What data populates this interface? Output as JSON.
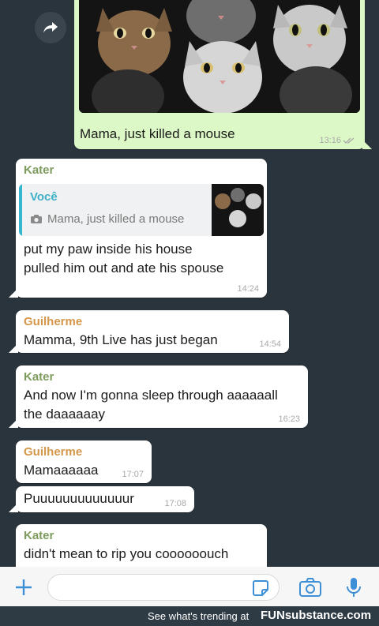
{
  "messages": [
    {
      "caption": "Mama, just killed a mouse",
      "time": "13:16"
    },
    {
      "sender": "Kater",
      "quote_sender": "Você",
      "quote_text": "Mama, just killed a mouse",
      "line1": "put my paw inside his house",
      "line2": "pulled him out and ate his spouse",
      "time": "14:24"
    },
    {
      "sender": "Guilherme",
      "text": "Mamma, 9th Live has just began",
      "time": "14:54"
    },
    {
      "sender": "Kater",
      "line1": "And now I'm gonna sleep through aaaaaall",
      "line2": "the daaaaaay",
      "time": "16:23"
    },
    {
      "sender": "Guilherme",
      "text": "Mamaaaaaa",
      "time": "17:07"
    },
    {
      "text": "Puuuuuuuuuuuuur",
      "time": "17:08"
    },
    {
      "sender": "Kater",
      "text": "didn't mean to rip you coooooouch"
    }
  ],
  "footer": {
    "text": "See what's trending at",
    "brand": "FUNsubstance.com"
  },
  "colors": {
    "chat_bg": "#2a343d",
    "outgoing": "#dcf8c6",
    "incoming": "#ffffff",
    "kater": "#7e9b5e",
    "guilherme": "#d4974a",
    "quote_accent": "#35b5ce"
  },
  "icons": [
    "forward-icon",
    "camera-icon",
    "read-receipt-icon",
    "plus-icon",
    "sticker-icon",
    "camera-icon",
    "microphone-icon"
  ]
}
